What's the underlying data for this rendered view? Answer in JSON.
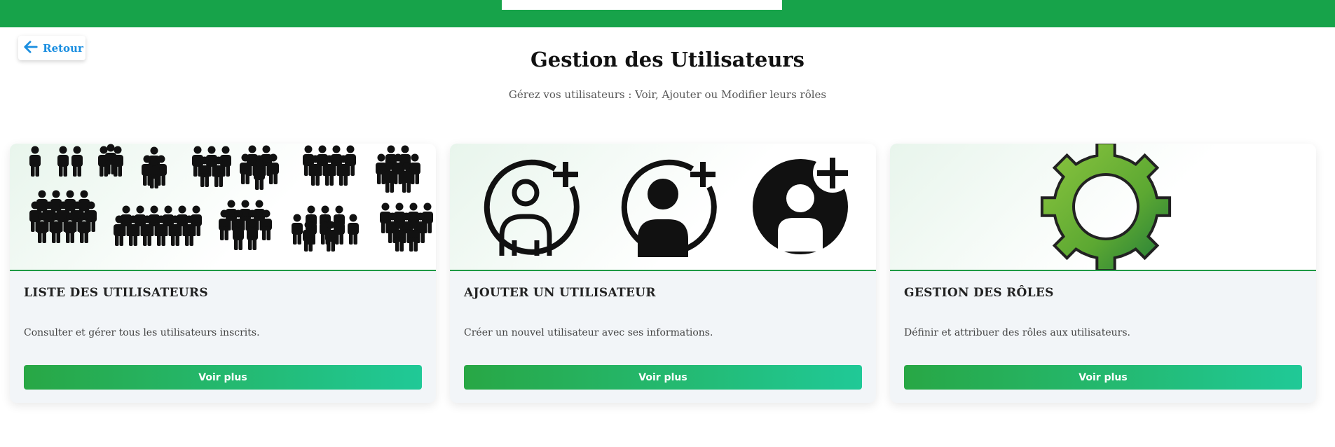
{
  "header": {
    "back_label": "Retour"
  },
  "page": {
    "title": "Gestion des Utilisateurs",
    "subtitle": "Gérez vos utilisateurs : Voir, Ajouter ou Modifier leurs rôles"
  },
  "cards": [
    {
      "title": "LISTE DES UTILISATEURS",
      "description": "Consulter et gérer tous les utilisateurs inscrits.",
      "button": "Voir plus",
      "image": "user-groups-icons"
    },
    {
      "title": "AJOUTER UN UTILISATEUR",
      "description": "Créer un nouvel utilisateur avec ses informations.",
      "button": "Voir plus",
      "image": "add-user-icons"
    },
    {
      "title": "GESTION DES RÔLES",
      "description": "Définir et attribuer des rôles aux utilisateurs.",
      "button": "Voir plus",
      "image": "gear-icon"
    }
  ],
  "colors": {
    "topbar": "#17a34a",
    "accent_start": "#28a745",
    "accent_end": "#20c997",
    "link": "#1a8ee0"
  }
}
